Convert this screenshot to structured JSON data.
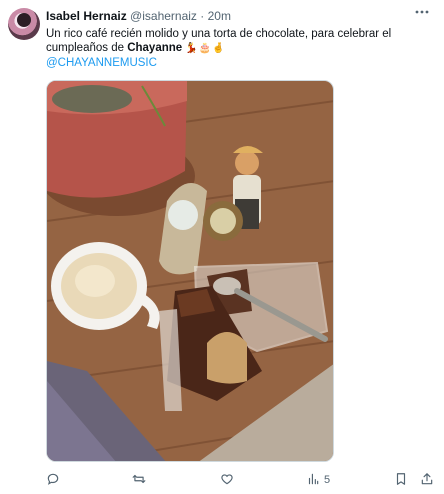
{
  "author": {
    "name": "Isabel Hernaiz",
    "handle": "@isahernaiz",
    "separator": "·",
    "time": "20m"
  },
  "post": {
    "text_prefix": "Un rico café recién molido y una torta de chocolate, para celebrar el cumpleaños de ",
    "text_bold": "Chayanne",
    "text_emojis": "💃🎂🤞",
    "mention": "@CHAYANNEMUSIC"
  },
  "icons": {
    "more": "more-icon",
    "reply": "reply-icon",
    "retweet": "retweet-icon",
    "like": "like-icon",
    "views": "views-icon",
    "bookmark": "bookmark-icon",
    "share": "share-icon"
  },
  "actions": {
    "views_count": "5"
  },
  "colors": {
    "link": "#1d9bf0",
    "secondary": "#536471",
    "text": "#0f1419"
  }
}
